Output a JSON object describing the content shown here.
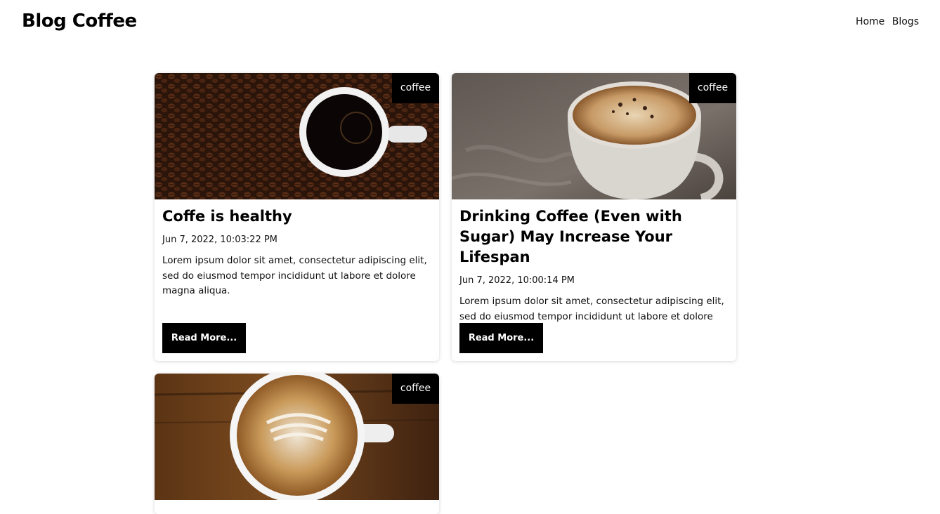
{
  "header": {
    "brand": "Blog Coffee",
    "nav": [
      {
        "label": "Home"
      },
      {
        "label": "Blogs"
      }
    ]
  },
  "posts": [
    {
      "tag": "coffee",
      "title": "Coffe is healthy",
      "date": "Jun 7, 2022, 10:03:22 PM",
      "excerpt": "Lorem ipsum dolor sit amet, consectetur adipiscing elit, sed do eiusmod tempor incididunt ut labore et dolore magna aliqua.",
      "cta": "Read More..."
    },
    {
      "tag": "coffee",
      "title": "Drinking Coffee (Even with Sugar) May Increase Your Lifespan",
      "date": "Jun 7, 2022, 10:00:14 PM",
      "excerpt": "Lorem ipsum dolor sit amet, consectetur adipiscing elit, sed do eiusmod tempor incididunt ut labore et dolore magna aliqua.",
      "cta": "Read More..."
    },
    {
      "tag": "coffee"
    }
  ]
}
